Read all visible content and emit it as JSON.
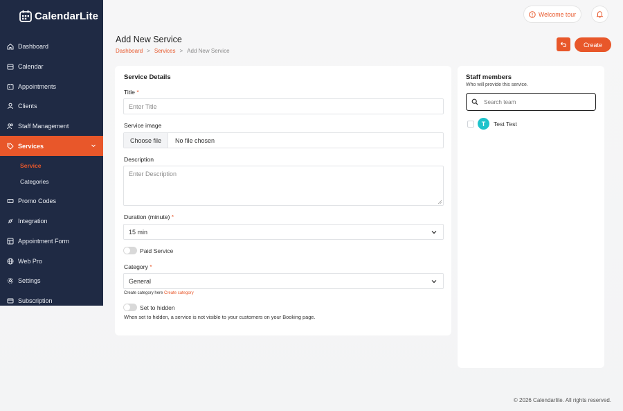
{
  "app": {
    "name": "CalendarLite"
  },
  "colors": {
    "accent": "#e8572a",
    "sidebar": "#1f2a44",
    "avatar": "#1ec3cb"
  },
  "sidebar": {
    "items": [
      {
        "label": "Dashboard",
        "icon": "home-icon"
      },
      {
        "label": "Calendar",
        "icon": "calendar-icon"
      },
      {
        "label": "Appointments",
        "icon": "appointments-icon"
      },
      {
        "label": "Clients",
        "icon": "user-icon"
      },
      {
        "label": "Staff Management",
        "icon": "users-icon"
      },
      {
        "label": "Services",
        "icon": "tag-icon",
        "active": true
      },
      {
        "label": "Promo Codes",
        "icon": "ticket-icon"
      },
      {
        "label": "Integration",
        "icon": "plug-icon"
      },
      {
        "label": "Appointment Form",
        "icon": "form-icon"
      },
      {
        "label": "Web Pro",
        "icon": "globe-icon"
      },
      {
        "label": "Settings",
        "icon": "gear-icon"
      },
      {
        "label": "Subscription",
        "icon": "card-icon"
      }
    ],
    "subitems": [
      {
        "label": "Service",
        "active": true
      },
      {
        "label": "Categories"
      }
    ]
  },
  "header": {
    "welcome_tour": "Welcome tour"
  },
  "page": {
    "title": "Add New Service",
    "breadcrumb": {
      "home": "Dashboard",
      "section": "Services",
      "current": "Add New Service",
      "sep": ">"
    },
    "create_label": "Create"
  },
  "service": {
    "heading": "Service Details",
    "title_label": "Title",
    "title_placeholder": "Enter Title",
    "image_label": "Service image",
    "choose_file": "Choose file",
    "no_file": "No file chosen",
    "description_label": "Description",
    "description_placeholder": "Enter Description",
    "duration_label": "Duration (minute)",
    "duration_value": "15 min",
    "paid_label": "Paid Service",
    "category_label": "Category",
    "category_value": "General",
    "create_category_prefix": "Create category here",
    "create_category_link": "Create category",
    "hidden_label": "Set to hidden",
    "hidden_note": "When set to hidden, a service is not visible to your customers on your Booking page.",
    "required_mark": "*"
  },
  "staff": {
    "heading": "Staff members",
    "subheading": "Who will provide this service.",
    "search_placeholder": "Search team",
    "members": [
      {
        "initial": "T",
        "name": "Test Test"
      }
    ]
  },
  "footer": {
    "copyright": "© 2026 Calendarlite. All rights reserved."
  }
}
